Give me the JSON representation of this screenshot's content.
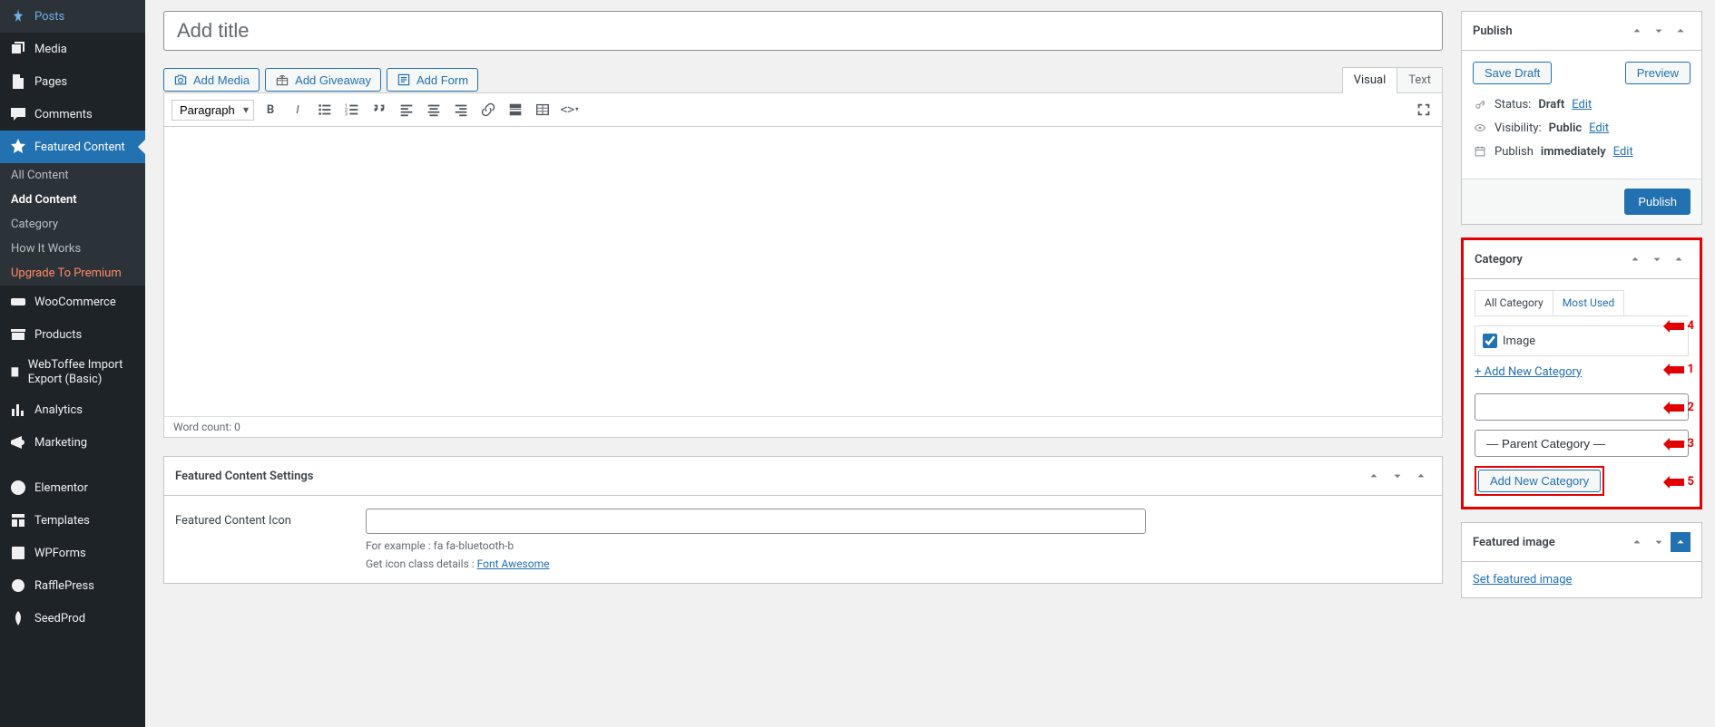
{
  "sidebar": {
    "items": [
      {
        "label": "Posts",
        "icon": "pin-icon"
      },
      {
        "label": "Media",
        "icon": "media-icon"
      },
      {
        "label": "Pages",
        "icon": "page-icon"
      },
      {
        "label": "Comments",
        "icon": "comment-icon"
      },
      {
        "label": "Featured Content",
        "icon": "star-icon"
      },
      {
        "label": "WooCommerce",
        "icon": "woo-icon"
      },
      {
        "label": "Products",
        "icon": "archive-icon"
      },
      {
        "label": "WebToffee Import Export (Basic)",
        "icon": "import-icon"
      },
      {
        "label": "Analytics",
        "icon": "chart-icon"
      },
      {
        "label": "Marketing",
        "icon": "megaphone-icon"
      },
      {
        "label": "Elementor",
        "icon": "elementor-icon"
      },
      {
        "label": "Templates",
        "icon": "templates-icon"
      },
      {
        "label": "WPForms",
        "icon": "wpforms-icon"
      },
      {
        "label": "RafflePress",
        "icon": "raffle-icon"
      },
      {
        "label": "SeedProd",
        "icon": "seed-icon"
      }
    ],
    "featured_sub": [
      {
        "label": "All Content"
      },
      {
        "label": "Add Content",
        "current": true
      },
      {
        "label": "Category"
      },
      {
        "label": "How It Works"
      },
      {
        "label": "Upgrade To Premium",
        "premium": true
      }
    ]
  },
  "title_placeholder": "Add title",
  "media_buttons": {
    "add_media": "Add Media",
    "add_giveaway": "Add Giveaway",
    "add_form": "Add Form"
  },
  "editor": {
    "format_default": "Paragraph",
    "tabs": {
      "visual": "Visual",
      "text": "Text"
    },
    "word_count": "Word count: 0"
  },
  "settings_box": {
    "title": "Featured Content Settings",
    "icon_label": "Featured Content Icon",
    "hint_example": "For example : fa fa-bluetooth-b",
    "hint_detail_pre": "Get icon class details : ",
    "hint_link": "Font Awesome"
  },
  "publish": {
    "title": "Publish",
    "save_draft": "Save Draft",
    "preview": "Preview",
    "status_label": "Status:",
    "status_value": "Draft",
    "visibility_label": "Visibility:",
    "visibility_value": "Public",
    "publish_label": "Publish",
    "publish_value": "immediately",
    "edit": "Edit",
    "submit": "Publish"
  },
  "category_panel": {
    "title": "Category",
    "tabs": {
      "all": "All Category",
      "most": "Most Used"
    },
    "items": [
      {
        "label": "Image",
        "checked": true
      }
    ],
    "add_link": "+ Add New Category",
    "parent_placeholder": "— Parent Category —",
    "add_button": "Add New Category",
    "annotations": [
      "1",
      "2",
      "3",
      "4",
      "5"
    ]
  },
  "featured_image": {
    "title": "Featured image",
    "link": "Set featured image"
  }
}
